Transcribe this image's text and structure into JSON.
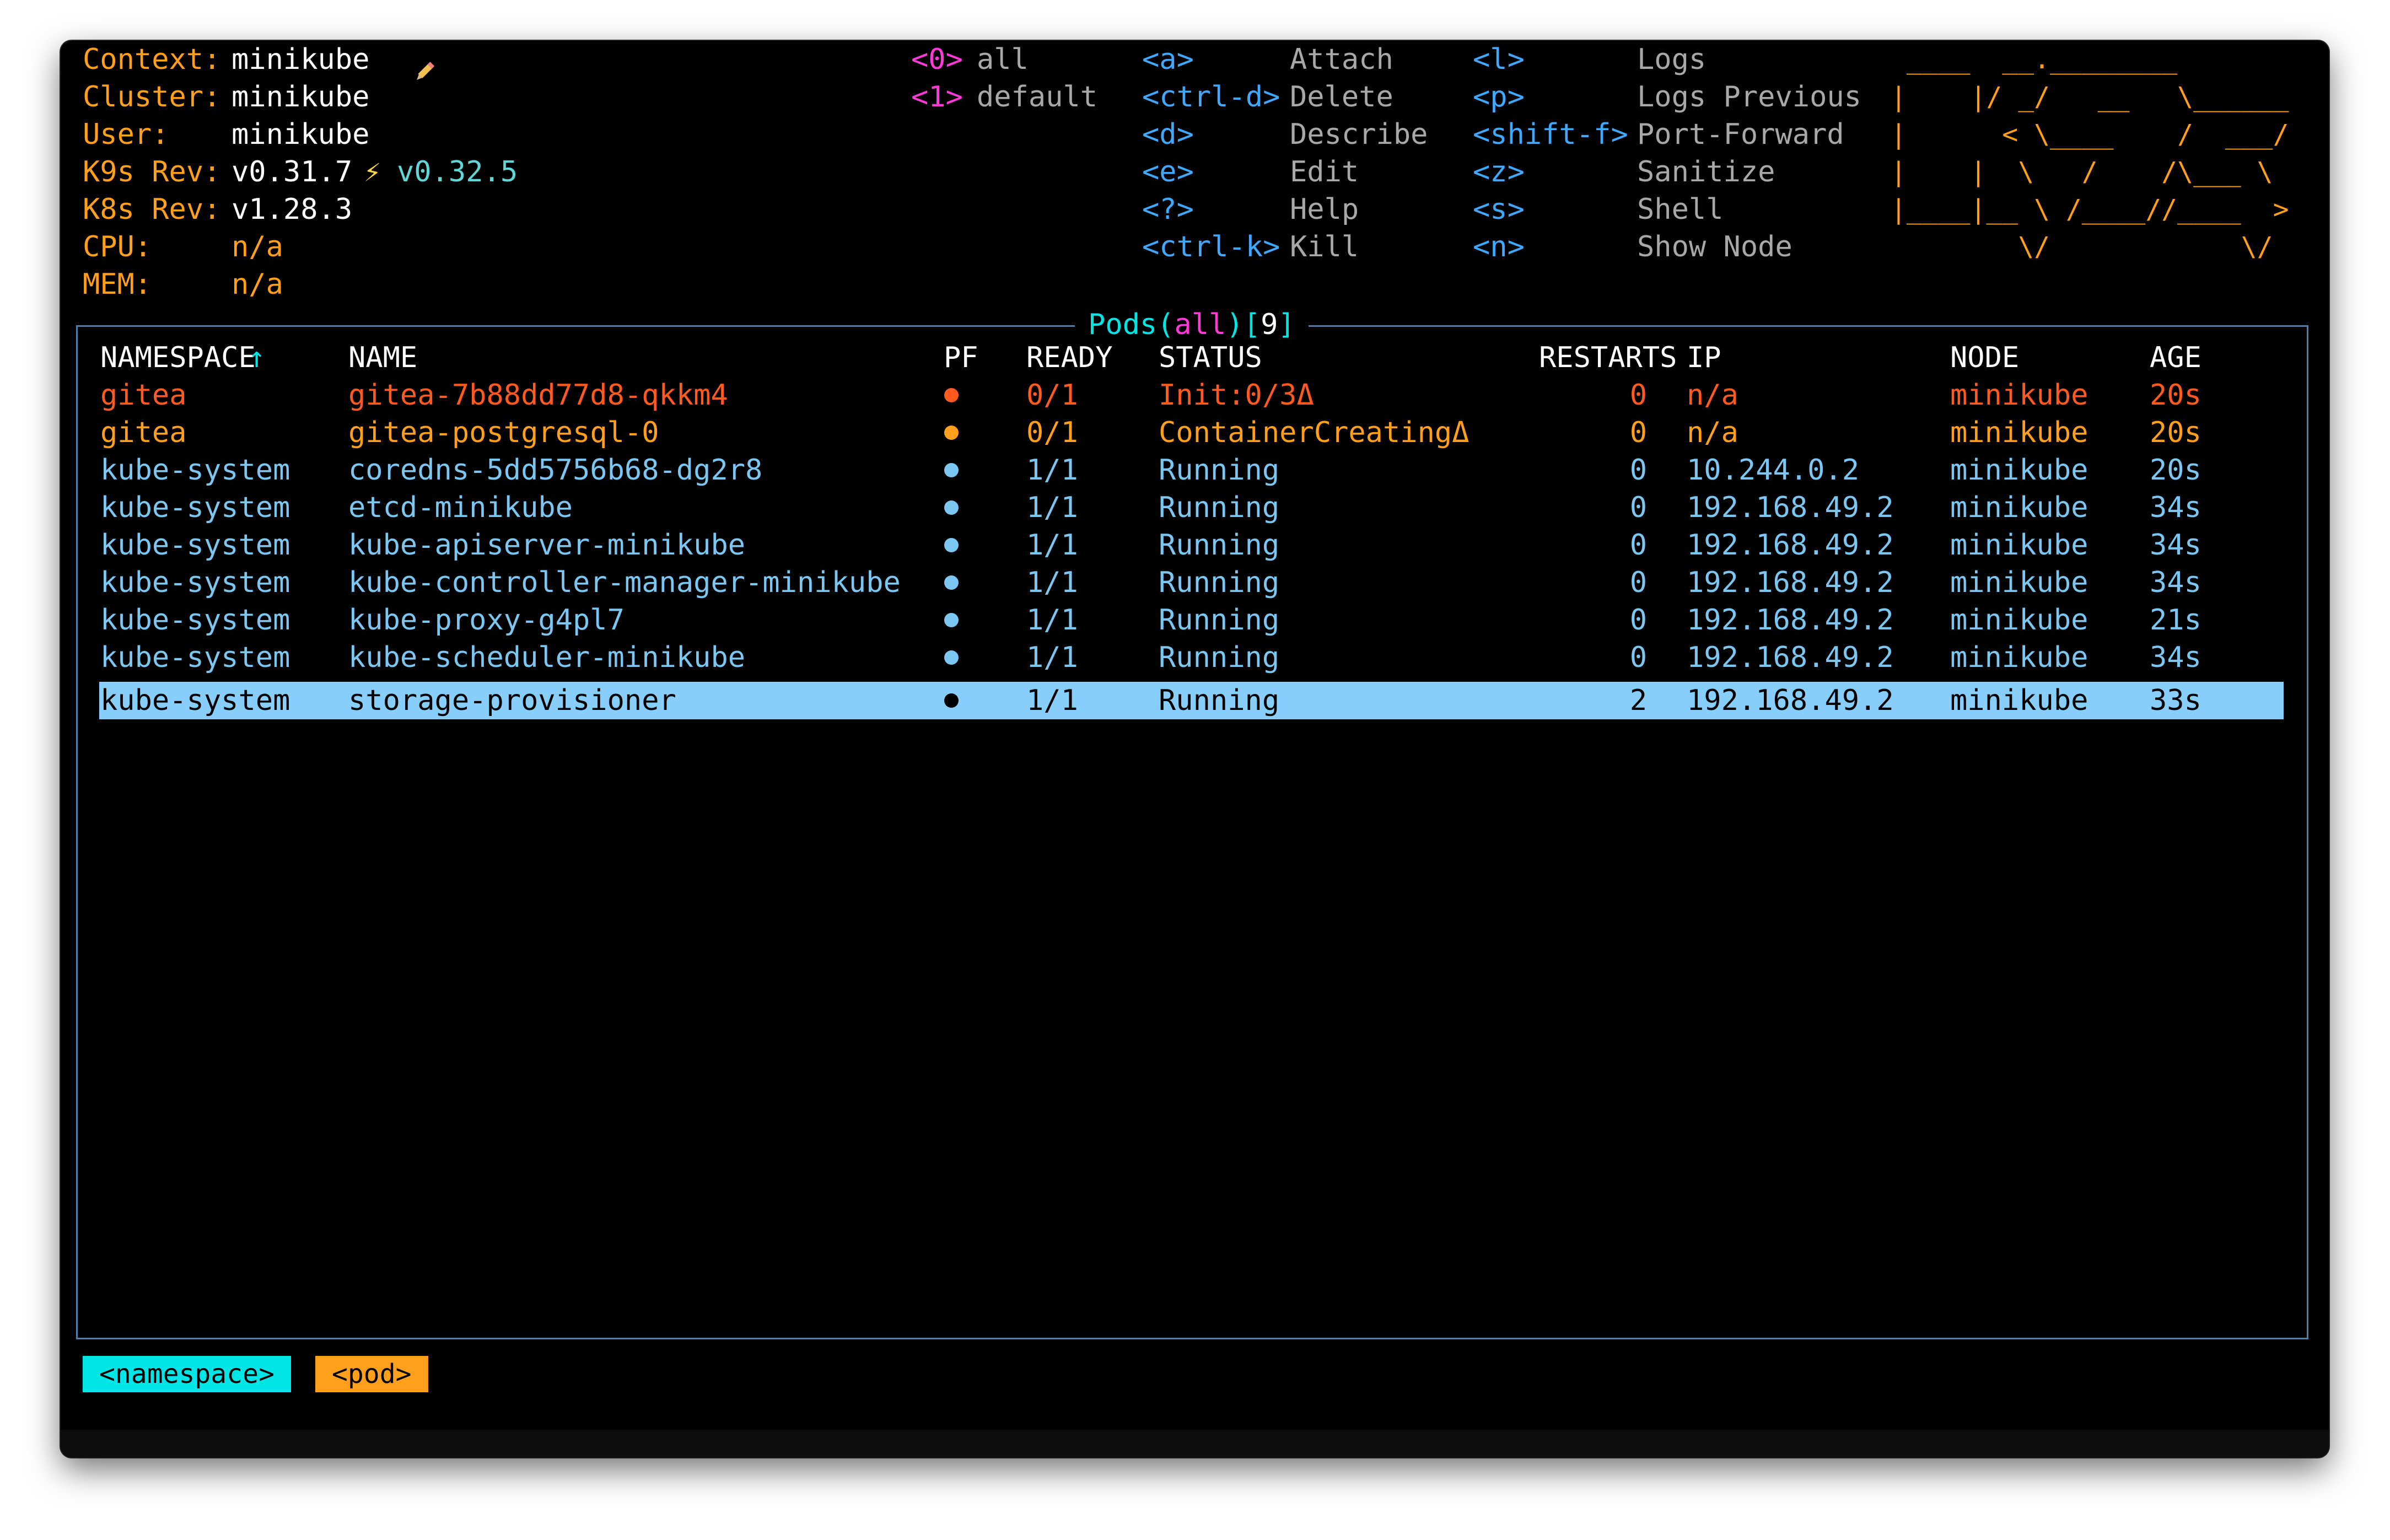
{
  "header": {
    "context_label": "Context:",
    "context_value": "minikube",
    "context_icon": "pencil-icon",
    "cluster_label": "Cluster:",
    "cluster_value": "minikube",
    "user_label": "User:",
    "user_value": "minikube",
    "k9s_rev_label": "K9s Rev:",
    "k9s_rev_value": "v0.31.7",
    "k9s_rev_new": "v0.32.5",
    "k8s_rev_label": "K8s Rev:",
    "k8s_rev_value": "v1.28.3",
    "cpu_label": "CPU:",
    "cpu_value": "n/a",
    "mem_label": "MEM:",
    "mem_value": "n/a"
  },
  "namespaces": [
    {
      "key": "<0>",
      "label": "all"
    },
    {
      "key": "<1>",
      "label": "default"
    }
  ],
  "shortcuts_col1": [
    {
      "key": "<a>",
      "label": "Attach"
    },
    {
      "key": "<ctrl-d>",
      "label": "Delete"
    },
    {
      "key": "<d>",
      "label": "Describe"
    },
    {
      "key": "<e>",
      "label": "Edit"
    },
    {
      "key": "<?>",
      "label": "Help"
    },
    {
      "key": "<ctrl-k>",
      "label": "Kill"
    }
  ],
  "shortcuts_col2": [
    {
      "key": "<l>",
      "label": "Logs"
    },
    {
      "key": "<p>",
      "label": "Logs Previous"
    },
    {
      "key": "<shift-f>",
      "label": "Port-Forward"
    },
    {
      "key": "<z>",
      "label": "Sanitize"
    },
    {
      "key": "<s>",
      "label": "Shell"
    },
    {
      "key": "<n>",
      "label": "Show Node"
    }
  ],
  "logo_lines": [
    " ____  __.________       ",
    "|    |/ _/   __   \\______",
    "|      < \\____    /  ___/",
    "|    |  \\   /    /\\___ \\ ",
    "|____|__ \\ /____//____  >",
    "        \\/            \\/ "
  ],
  "table": {
    "title": "Pods",
    "scope": "all",
    "count": "9",
    "sort_arrow": "↑",
    "columns": [
      "NAMESPACE",
      "NAME",
      "PF",
      "READY",
      "STATUS",
      "RESTARTS",
      "IP",
      "NODE",
      "AGE"
    ],
    "rows": [
      {
        "namespace": "gitea",
        "name": "gitea-7b88dd77d8-qkkm4",
        "pf": "●",
        "ready": "0/1",
        "status": "Init:0/3Δ",
        "restarts": "0",
        "ip": "n/a",
        "node": "minikube",
        "age": "20s",
        "tone": "red"
      },
      {
        "namespace": "gitea",
        "name": "gitea-postgresql-0",
        "pf": "●",
        "ready": "0/1",
        "status": "ContainerCreatingΔ",
        "restarts": "0",
        "ip": "n/a",
        "node": "minikube",
        "age": "20s",
        "tone": "orange"
      },
      {
        "namespace": "kube-system",
        "name": "coredns-5dd5756b68-dg2r8",
        "pf": "●",
        "ready": "1/1",
        "status": "Running",
        "restarts": "0",
        "ip": "10.244.0.2",
        "node": "minikube",
        "age": "20s",
        "tone": "blue"
      },
      {
        "namespace": "kube-system",
        "name": "etcd-minikube",
        "pf": "●",
        "ready": "1/1",
        "status": "Running",
        "restarts": "0",
        "ip": "192.168.49.2",
        "node": "minikube",
        "age": "34s",
        "tone": "blue"
      },
      {
        "namespace": "kube-system",
        "name": "kube-apiserver-minikube",
        "pf": "●",
        "ready": "1/1",
        "status": "Running",
        "restarts": "0",
        "ip": "192.168.49.2",
        "node": "minikube",
        "age": "34s",
        "tone": "blue"
      },
      {
        "namespace": "kube-system",
        "name": "kube-controller-manager-minikube",
        "pf": "●",
        "ready": "1/1",
        "status": "Running",
        "restarts": "0",
        "ip": "192.168.49.2",
        "node": "minikube",
        "age": "34s",
        "tone": "blue"
      },
      {
        "namespace": "kube-system",
        "name": "kube-proxy-g4pl7",
        "pf": "●",
        "ready": "1/1",
        "status": "Running",
        "restarts": "0",
        "ip": "192.168.49.2",
        "node": "minikube",
        "age": "21s",
        "tone": "blue"
      },
      {
        "namespace": "kube-system",
        "name": "kube-scheduler-minikube",
        "pf": "●",
        "ready": "1/1",
        "status": "Running",
        "restarts": "0",
        "ip": "192.168.49.2",
        "node": "minikube",
        "age": "34s",
        "tone": "blue"
      },
      {
        "namespace": "kube-system",
        "name": "storage-provisioner",
        "pf": "●",
        "ready": "1/1",
        "status": "Running",
        "restarts": "2",
        "ip": "192.168.49.2",
        "node": "minikube",
        "age": "33s",
        "tone": "selected"
      }
    ]
  },
  "breadcrumbs": [
    "<namespace>",
    "<pod>"
  ],
  "colors": {
    "label_orange": "#ff9f1a",
    "key_blue": "#3fa8ff",
    "key_magenta": "#ff3ad9",
    "title_cyan": "#00e5e5",
    "row_error": "#ff5a1f",
    "row_pending": "#ff9f1a",
    "row_running": "#7cc6f2",
    "selection": "#87cefa"
  }
}
